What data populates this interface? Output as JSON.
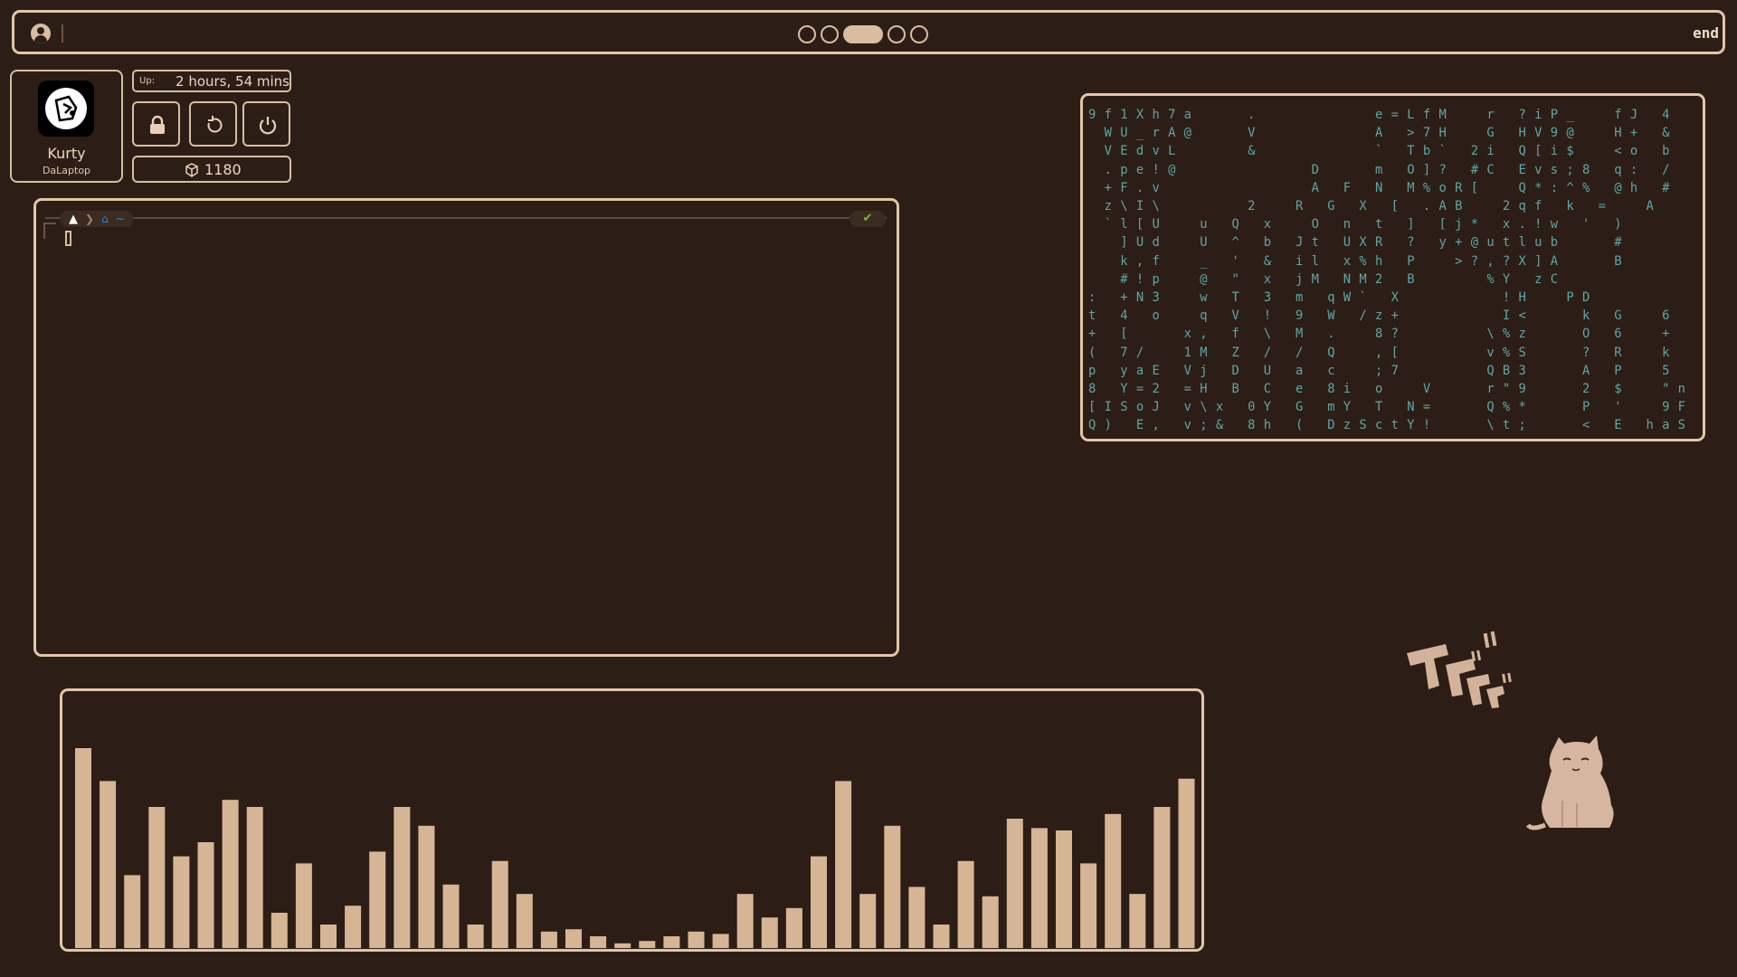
{
  "topbar": {
    "workspaces": [
      {
        "active": false
      },
      {
        "active": false
      },
      {
        "active": true
      },
      {
        "active": false
      },
      {
        "active": false
      }
    ],
    "clock": "end"
  },
  "profile": {
    "name": "Kurty",
    "host": "DaLaptop"
  },
  "uptime": {
    "label": "Up:",
    "value": "2 hours, 54 mins"
  },
  "packages": {
    "count": "1180"
  },
  "terminal": {
    "path": "~",
    "status": "✔"
  },
  "matrix": {
    "rows": [
      "9 f 1 X h 7 a       .               e = L f M     r   ? i P _     f J   4",
      "  W U _ r A @       V               A   > 7 H     G   H V 9 @     H +   &",
      "  V E d v L         &               `   T b `   2 i   Q [ i $     < o   b",
      "  . p e ! @                 D       m   O ] ?   # C   E v s ; 8   q :   /",
      "  + F . v                   A   F   N   M % o R [     Q * : ^ %   @ h   #",
      "  z \\ I \\           2     R   G   X   [   . A B     2 q f   k   =     A",
      "  ` l [ U     u   Q   x     O   n   t   ]   [ j *   x . ! w   '   )",
      "    ] U d     U   ^   b   J t   U X R   ?   y + @ u t l u b       #",
      "    k , f     _   '   &   i l   x % h   P     > ? , ? X ] A       B",
      "    # ! p     @   \"   x   j M   N M 2   B         % Y   z C",
      ":   + N 3     w   T   3   m   q W `   X             ! H     P D",
      "t   4   o     q   V   !   9   W   / z +             I <       k   G     6",
      "+   [       x ,   f   \\   M   .     8 ?           \\ % z       O   6     +",
      "(   7 /     1 M   Z   /   /   Q     , [           v % S       ?   R     k",
      "p   y a E   V j   D   U   a   c     ; 7           Q B 3       A   P     5",
      "8   Y = 2   = H   B   C   e   8 i   o     V       r \" 9       2   $     \" n",
      "[ I S o J   v \\ x   0 Y   G   m Y   T   N =       Q % *       P   '     9 F",
      "Q )   E ,   v ; &   8 h   (   D z S c t Y !       \\ t ;       <   E   h a S"
    ]
  },
  "visualizer": {
    "levels": [
      0.85,
      0.71,
      0.31,
      0.6,
      0.39,
      0.45,
      0.63,
      0.6,
      0.15,
      0.36,
      0.1,
      0.18,
      0.41,
      0.6,
      0.52,
      0.27,
      0.1,
      0.37,
      0.23,
      0.07,
      0.08,
      0.05,
      0.02,
      0.03,
      0.05,
      0.07,
      0.06,
      0.23,
      0.13,
      0.17,
      0.39,
      0.71,
      0.23,
      0.52,
      0.26,
      0.1,
      0.37,
      0.22,
      0.55,
      0.51,
      0.5,
      0.36,
      0.57,
      0.23,
      0.6,
      0.72
    ],
    "bar_color": "#d6b595"
  },
  "colors": {
    "background": "#2c1e16",
    "border": "#e2c5a8",
    "matrix": "#5fa6a6"
  }
}
